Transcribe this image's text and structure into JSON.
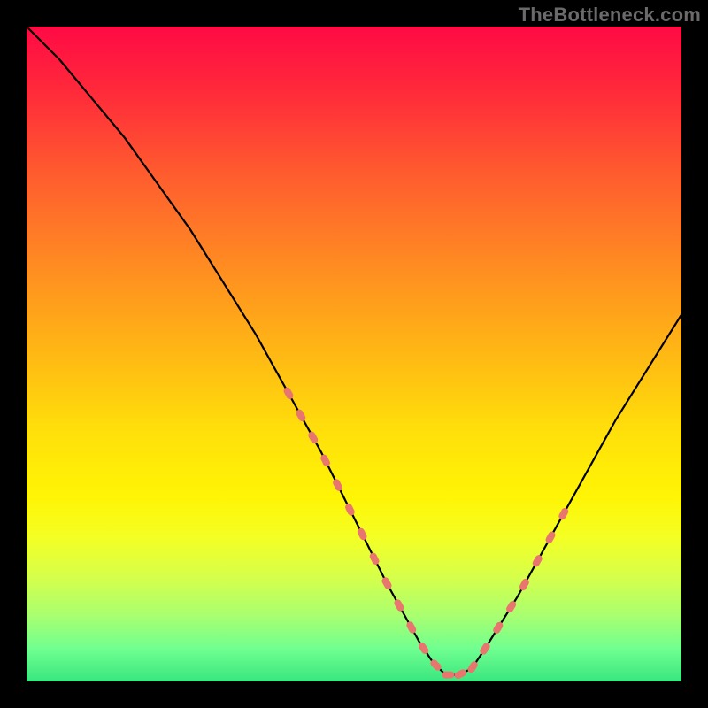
{
  "watermark": "TheBottleneck.com",
  "colors": {
    "background": "#000000",
    "curve": "#000000",
    "markers": "#e9766e",
    "gradient_top": "#ff0a45",
    "gradient_bottom": "#39e67f"
  },
  "chart_data": {
    "type": "line",
    "title": "",
    "xlabel": "",
    "ylabel": "",
    "xlim": [
      0,
      100
    ],
    "ylim": [
      0,
      100
    ],
    "grid": false,
    "series": [
      {
        "name": "bottleneck-curve",
        "x": [
          0,
          5,
          10,
          15,
          20,
          25,
          30,
          35,
          40,
          45,
          50,
          55,
          60,
          62,
          64,
          66,
          68,
          70,
          75,
          80,
          85,
          90,
          95,
          100
        ],
        "values": [
          100,
          95,
          89,
          83,
          76,
          69,
          61,
          53,
          44,
          35,
          25,
          15,
          6,
          3,
          1,
          1,
          2,
          5,
          13,
          22,
          31,
          40,
          48,
          56
        ]
      }
    ],
    "markers": [
      {
        "name": "left-cluster",
        "x_range": [
          40,
          55
        ],
        "y_range": [
          6,
          35
        ]
      },
      {
        "name": "valley-cluster",
        "x_range": [
          55,
          70
        ],
        "y_range": [
          1,
          6
        ]
      },
      {
        "name": "right-cluster",
        "x_range": [
          70,
          82
        ],
        "y_range": [
          5,
          24
        ]
      }
    ],
    "annotations": []
  }
}
